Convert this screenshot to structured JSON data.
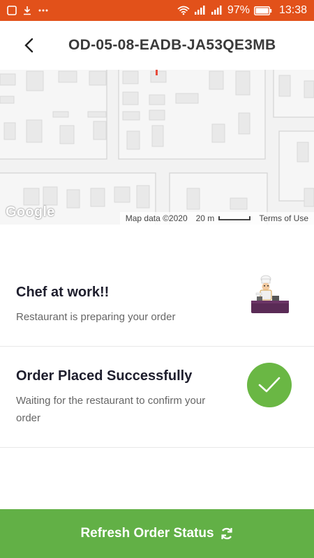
{
  "status_bar": {
    "battery": "97%",
    "time": "13:38",
    "icons": [
      "notification-icon",
      "download-icon",
      "more-icon",
      "wifi-icon",
      "signal-icon",
      "signal-icon",
      "battery-icon"
    ]
  },
  "header": {
    "title": "OD-05-08-EADB-JA53QE3MB",
    "back_icon": "back-arrow-icon"
  },
  "map": {
    "logo": "Google",
    "data_text": "Map data ©2020",
    "scale_label": "20 m",
    "terms": "Terms of Use"
  },
  "order_status": [
    {
      "title": "Chef at work!!",
      "subtitle": "Restaurant is preparing your order",
      "icon": "chef-icon"
    },
    {
      "title": "Order Placed Successfully",
      "subtitle": "Waiting for the restaurant to confirm your order",
      "icon": "check-icon"
    }
  ],
  "footer": {
    "refresh_label": "Refresh Order Status",
    "refresh_icon": "refresh-icon"
  },
  "colors": {
    "status_bar": "#e2511a",
    "success_green": "#6ab744",
    "button_green": "#62b046"
  }
}
